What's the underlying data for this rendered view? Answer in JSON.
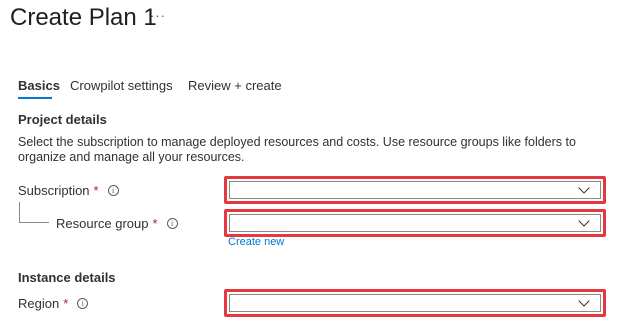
{
  "page": {
    "title": "Create Plan 1",
    "more_label": "···"
  },
  "tabs": [
    {
      "label": "Basics",
      "active": true
    },
    {
      "label": "Crowpilot settings",
      "active": false
    },
    {
      "label": "Review + create",
      "active": false
    }
  ],
  "project": {
    "heading": "Project details",
    "description": "Select the subscription to manage deployed resources and costs. Use resource groups like folders to organize and manage all your resources.",
    "subscription": {
      "label": "Subscription",
      "required": "*",
      "info": "i",
      "value": "",
      "icon": "chevron-down-icon"
    },
    "resource_group": {
      "label": "Resource group",
      "required": "*",
      "info": "i",
      "value": "",
      "icon": "chevron-down-icon",
      "create_link": "Create new"
    }
  },
  "instance": {
    "heading": "Instance details",
    "region": {
      "label": "Region",
      "required": "*",
      "info": "i",
      "value": "",
      "icon": "chevron-down-icon"
    }
  },
  "colors": {
    "accent": "#0078d4",
    "highlight": "#e5383f",
    "required": "#a4262c"
  }
}
